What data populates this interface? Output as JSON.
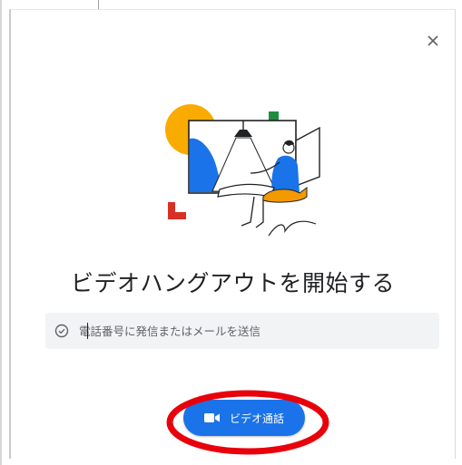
{
  "dialog": {
    "close_label": "×",
    "title": "ビデオハングアウトを開始する",
    "invite_placeholder": "電話番号に発信またはメールを送信",
    "video_call_label": "ビデオ通話"
  },
  "colors": {
    "accent": "#1a73e8",
    "highlight": "#e8000b",
    "field_bg": "#f1f3f4",
    "illustration_yellow": "#f9ab00",
    "illustration_green": "#1e8e3e",
    "illustration_red": "#d93025",
    "illustration_blue": "#1a73e8",
    "illustration_orange": "#f29900"
  },
  "icons": {
    "close": "close-icon",
    "check": "check-circle-icon",
    "camera": "videocam-icon"
  }
}
